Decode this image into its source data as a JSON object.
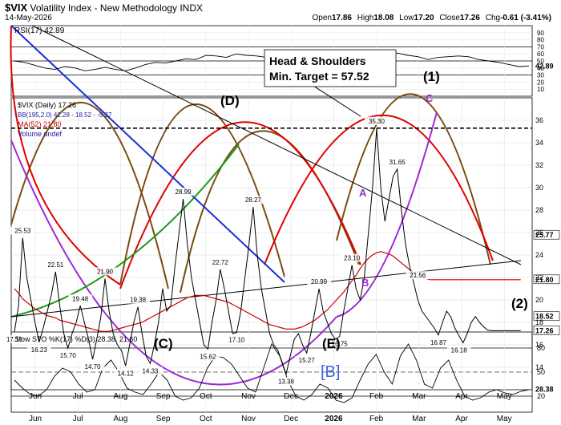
{
  "header": {
    "symbol": "$VIX",
    "name": "Volatility Index - New Methodology",
    "exchange": "INDX",
    "date": "14-May-2026",
    "open_label": "Open",
    "open": "17.86",
    "high_label": "High",
    "high": "18.08",
    "low_label": "Low",
    "low": "17.20",
    "close_label": "Close",
    "close": "17.26",
    "chg_label": "Chg",
    "chg": "-0.61 (-3.41%)"
  },
  "rsi": {
    "label": "RSI(17) 42.89",
    "last": "42.89",
    "ylim": [
      0,
      100
    ],
    "ticks": [
      90,
      80,
      70,
      60,
      50,
      40,
      30,
      20,
      10
    ],
    "levels": [
      70,
      50,
      30
    ]
  },
  "price_legend": {
    "line1": "$VIX (Daily) 17.26",
    "line2": "BB(195,2.0) 41.28 - 18.52 - -5.27",
    "line3": "MA(52) 21.80",
    "line4": "Volume undef"
  },
  "annotations": {
    "hs_title": "Head & Shoulders",
    "hs_target": "Min. Target = 57.52",
    "wave_1": "(1)",
    "wave_2": "(2)",
    "wave_D": "(D)",
    "wave_A": "A",
    "wave_B": "B",
    "wave_C": "C",
    "wave_C_paren": "(C)",
    "wave_E": "(E)",
    "wave_B_bracket": "[B]"
  },
  "sto": {
    "label": "Slow STO %K(17) %D(3) 28.38, 21.60",
    "last": "28.38",
    "ylim": [
      0,
      100
    ],
    "ticks": [
      80,
      50,
      20
    ],
    "levels": [
      80,
      50,
      20
    ]
  },
  "colors": {
    "price": "#000000",
    "ma": "#cc0000",
    "bb": "#1a1aa8",
    "rsi": "#000000",
    "sto_k": "#000000",
    "sto_d": "#cc0000",
    "hs_line": "#000000",
    "cycle_brown": "#7a4a10",
    "cycle_red": "#e00000",
    "cycle_purple": "#9b2bd6",
    "cycle_blue": "#1a2fd6",
    "cycle_green": "#1a9a1a",
    "olive": "#8a7a20"
  },
  "chart_data": [
    {
      "type": "line",
      "title": "RSI(17) 42.89",
      "ylim": [
        0,
        100
      ],
      "y_ticks": [
        90,
        80,
        70,
        60,
        50,
        40,
        30,
        20,
        10
      ],
      "grid": true,
      "series": [
        {
          "values": [
            50,
            48,
            44,
            40,
            38,
            42,
            40,
            36,
            38,
            41,
            38,
            36,
            40,
            45,
            48,
            47,
            50,
            53,
            52,
            58,
            57,
            55,
            60,
            58,
            57,
            55,
            58,
            55,
            52,
            53,
            57,
            55,
            53,
            56,
            58,
            56,
            58,
            62,
            61,
            58,
            56,
            52,
            55,
            56,
            57,
            56,
            52,
            50,
            48,
            45,
            42,
            43
          ]
        }
      ],
      "last_value": 42.89
    },
    {
      "type": "line",
      "title": "$VIX (Daily) 17.26",
      "legend": [
        "$VIX (Daily) 17.26",
        "BB(195,2.0) 41.28 - 18.52 - -5.27",
        "MA(52) 21.80",
        "Volume undef"
      ],
      "ylim": [
        12,
        38
      ],
      "y_ticks": [
        36,
        34,
        32,
        30,
        28,
        26,
        24,
        22,
        20,
        18,
        16,
        14
      ],
      "x_tick_labels": [
        "Jun",
        "Jul",
        "Aug",
        "Sep",
        "Oct",
        "Nov",
        "Dec",
        "2026",
        "Feb",
        "Mar",
        "Apr",
        "May"
      ],
      "grid": true,
      "x": [
        0,
        2,
        4,
        6,
        8,
        10,
        12,
        14,
        16,
        18,
        20,
        22,
        24,
        26,
        28,
        30,
        32,
        34,
        36,
        38,
        40,
        42,
        44,
        46,
        48,
        50,
        52,
        54,
        56,
        58,
        60,
        62,
        64,
        66,
        68,
        70,
        72,
        74,
        76,
        78,
        80,
        82,
        84,
        86,
        88,
        90,
        92,
        94,
        96,
        98,
        100,
        102,
        104,
        106,
        108,
        110,
        112,
        114,
        116,
        118,
        120,
        122,
        124,
        126,
        128,
        130,
        132,
        134,
        136,
        138,
        140,
        142,
        144,
        146,
        148,
        150,
        152,
        154,
        156,
        158,
        160,
        162,
        164,
        166,
        168,
        170,
        172,
        174,
        176,
        178,
        180,
        182,
        184,
        186,
        188,
        190,
        192,
        194,
        196,
        198,
        200,
        202,
        204,
        206,
        208,
        210,
        212,
        214,
        216,
        218,
        220,
        222,
        224,
        226,
        228,
        230,
        232,
        234,
        236,
        238,
        240,
        242,
        244,
        246,
        248,
        250
      ],
      "series": [
        {
          "values": [
            17.15,
            19.5,
            25.53,
            22,
            20,
            18,
            16.23,
            17.5,
            19,
            20.5,
            22.51,
            19.5,
            17,
            15.7,
            17,
            18,
            19.48,
            18,
            16.5,
            14.7,
            16.5,
            18.5,
            21.9,
            19,
            17,
            16,
            15.5,
            14.12,
            16,
            18,
            19.38,
            17,
            15,
            14.33,
            16,
            18,
            21,
            19,
            19.5,
            23,
            26,
            28.99,
            25,
            22,
            20,
            18,
            16,
            15.62,
            18,
            20,
            22.72,
            21,
            19,
            17,
            17.1,
            19,
            22,
            25,
            28.27,
            24,
            21,
            19,
            17,
            16,
            15.5,
            14.5,
            13.38,
            15,
            16.5,
            17,
            16,
            15.27,
            17,
            19,
            20.99,
            19,
            18,
            17,
            16.5,
            16.75,
            19,
            21,
            23.1,
            21,
            20,
            22,
            26,
            30,
            35.3,
            30,
            27,
            29,
            31,
            31.65,
            28,
            25,
            23,
            21.56,
            20,
            19,
            18.5,
            18,
            17.5,
            16.87,
            18,
            19,
            18.5,
            17.5,
            16.8,
            16.18,
            17,
            18,
            18.52,
            18,
            17.6,
            17.3,
            17.26,
            17.26,
            17.26,
            17.26,
            17.26,
            17.26,
            17.26,
            17.26
          ]
        },
        {
          "values": [
            21,
            20.6,
            20.1,
            19.8,
            19.5,
            19.2,
            19,
            18.8,
            18.6,
            18.5,
            18.4,
            18.2,
            18.1,
            18,
            17.9,
            17.8,
            17.7,
            17.6,
            17.5,
            17.4,
            17.3,
            17.2,
            17.2,
            17.2,
            17.3,
            17.4,
            17.5,
            17.6,
            17.7,
            17.8,
            17.9,
            18,
            18.2,
            18.4,
            18.6,
            18.8,
            19,
            19.2,
            19.4,
            19.6,
            19.8,
            20,
            20.2,
            20.3,
            20.4,
            20.4,
            20.4,
            20.3,
            20.2,
            20.1,
            20,
            19.9,
            19.8,
            19.6,
            19.4,
            19.2,
            19,
            18.8,
            18.6,
            18.4,
            18.2,
            18,
            17.8,
            17.7,
            17.6,
            17.5,
            17.4,
            17.4,
            17.4,
            17.5,
            17.6,
            17.8,
            18,
            18.2,
            18.5,
            18.8,
            19.1,
            19.5,
            19.9,
            20.3,
            20.7,
            21.2,
            21.7,
            22.2,
            22.8,
            23.3,
            23.7,
            24,
            24.2,
            24.3,
            24.2,
            24.1,
            23.9,
            23.6,
            23.3,
            23,
            22.7,
            22.4,
            22.2,
            22,
            21.9,
            21.8,
            21.8,
            21.8,
            21.8,
            21.8,
            21.8,
            21.8,
            21.8,
            21.8,
            21.8,
            21.8,
            21.8,
            21.8,
            21.8,
            21.8,
            21.8,
            21.8,
            21.8,
            21.8,
            21.8,
            21.8,
            21.8,
            21.8
          ]
        }
      ],
      "data_labels": [
        {
          "x": 0,
          "y": 17.15,
          "label": "17.15"
        },
        {
          "x": 4,
          "y": 25.53,
          "label": "25.53"
        },
        {
          "x": 12,
          "y": 16.23,
          "label": "16.23"
        },
        {
          "x": 20,
          "y": 22.51,
          "label": "22.51"
        },
        {
          "x": 26,
          "y": 15.7,
          "label": "15.70"
        },
        {
          "x": 32,
          "y": 19.48,
          "label": "19.48"
        },
        {
          "x": 38,
          "y": 14.7,
          "label": "14.70"
        },
        {
          "x": 44,
          "y": 21.9,
          "label": "21.90"
        },
        {
          "x": 54,
          "y": 14.12,
          "label": "14.12"
        },
        {
          "x": 60,
          "y": 19.38,
          "label": "19.38"
        },
        {
          "x": 66,
          "y": 14.33,
          "label": "14.33"
        },
        {
          "x": 82,
          "y": 28.99,
          "label": "28.99"
        },
        {
          "x": 94,
          "y": 15.62,
          "label": "15.62"
        },
        {
          "x": 100,
          "y": 22.72,
          "label": "22.72"
        },
        {
          "x": 108,
          "y": 17.1,
          "label": "17.10"
        },
        {
          "x": 116,
          "y": 28.27,
          "label": "28.27"
        },
        {
          "x": 132,
          "y": 13.38,
          "label": "13.38"
        },
        {
          "x": 142,
          "y": 15.27,
          "label": "15.27"
        },
        {
          "x": 148,
          "y": 20.99,
          "label": "20.99"
        },
        {
          "x": 158,
          "y": 16.75,
          "label": "16.75"
        },
        {
          "x": 164,
          "y": 23.1,
          "label": "23.10"
        },
        {
          "x": 176,
          "y": 35.3,
          "label": "35.30"
        },
        {
          "x": 186,
          "y": 31.65,
          "label": "31.65"
        },
        {
          "x": 196,
          "y": 21.56,
          "label": "21.56"
        },
        {
          "x": 206,
          "y": 16.87,
          "label": "16.87"
        },
        {
          "x": 216,
          "y": 16.18,
          "label": "16.18"
        }
      ],
      "right_labels": [
        {
          "y": 25.77,
          "label": "25.77"
        },
        {
          "y": 21.8,
          "label": "21.80"
        },
        {
          "y": 18.52,
          "label": "18.52"
        },
        {
          "y": 17.26,
          "label": "17.26"
        }
      ]
    },
    {
      "type": "line",
      "title": "Slow STO %K(17) %D(3) 28.38, 21.60",
      "ylim": [
        0,
        100
      ],
      "y_ticks": [
        80,
        50,
        20
      ],
      "grid": true,
      "series": [
        {
          "values": [
            40,
            30,
            22,
            20,
            28,
            45,
            55,
            50,
            35,
            25,
            28,
            55,
            65,
            50,
            30,
            25,
            22,
            35,
            50,
            40,
            20,
            15,
            18,
            30,
            55,
            70,
            68,
            60,
            45,
            30,
            25,
            55,
            85,
            70,
            40,
            20,
            15,
            22,
            35,
            30,
            15,
            12,
            18,
            40,
            60,
            72,
            50,
            35,
            70,
            85,
            65,
            35,
            30,
            55,
            65,
            40,
            20,
            15,
            18,
            25,
            28,
            24,
            22,
            26,
            28
          ]
        }
      ],
      "last_value": 28.38
    }
  ]
}
